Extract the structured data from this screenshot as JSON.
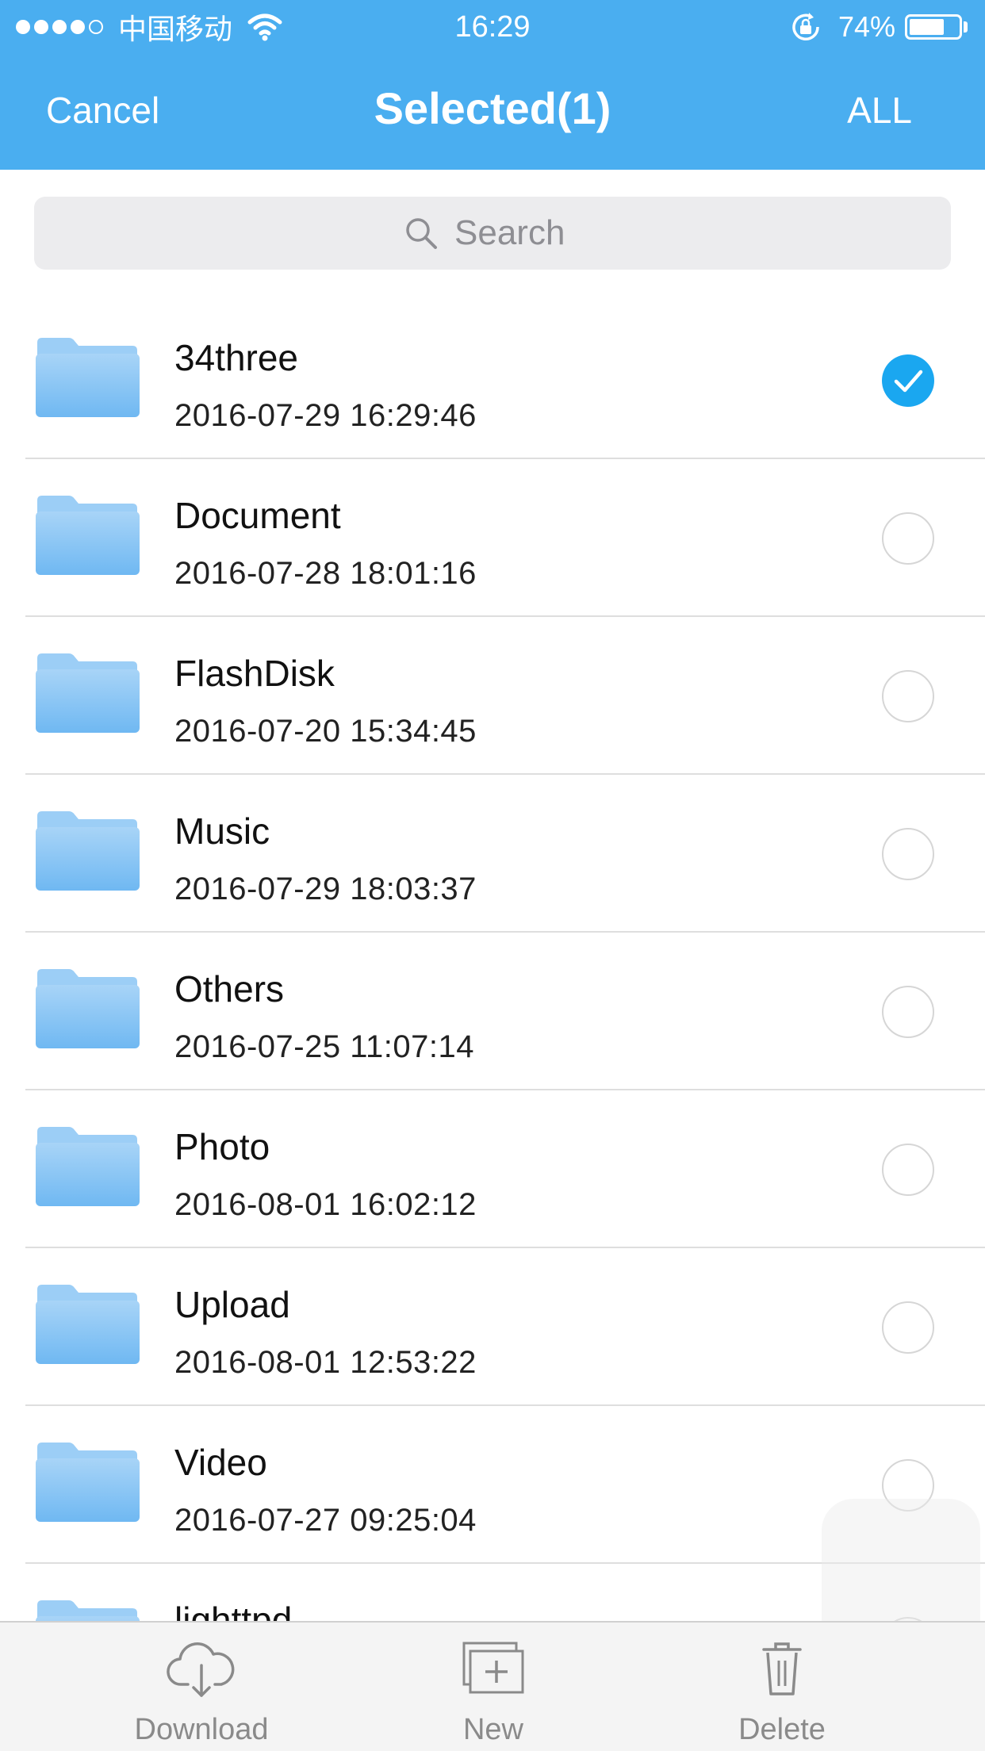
{
  "status_bar": {
    "carrier": "中国移动",
    "time": "16:29",
    "battery": "74%",
    "battery_level": 0.74,
    "signal_dots_filled": 4,
    "signal_dots_total": 5
  },
  "nav": {
    "cancel_label": "Cancel",
    "title": "Selected(1)",
    "all_label": "ALL"
  },
  "search": {
    "placeholder": "Search"
  },
  "files": [
    {
      "name": "34three",
      "date": "2016-07-29 16:29:46",
      "selected": true
    },
    {
      "name": "Document",
      "date": "2016-07-28 18:01:16",
      "selected": false
    },
    {
      "name": "FlashDisk",
      "date": "2016-07-20 15:34:45",
      "selected": false
    },
    {
      "name": "Music",
      "date": "2016-07-29 18:03:37",
      "selected": false
    },
    {
      "name": "Others",
      "date": "2016-07-25 11:07:14",
      "selected": false
    },
    {
      "name": "Photo",
      "date": "2016-08-01 16:02:12",
      "selected": false
    },
    {
      "name": "Upload",
      "date": "2016-08-01 12:53:22",
      "selected": false
    },
    {
      "name": "Video",
      "date": "2016-07-27 09:25:04",
      "selected": false
    },
    {
      "name": "lighttpd",
      "date": "",
      "selected": false
    }
  ],
  "toolbar": {
    "download_label": "Download",
    "new_label": "New",
    "delete_label": "Delete"
  },
  "colors": {
    "accent": "#4aaef0",
    "check": "#1aa7f0",
    "folder": "#8fc8f5"
  },
  "icons": [
    "wifi-icon",
    "rotation-lock-icon",
    "battery-icon",
    "search-icon",
    "folder-icon",
    "checkmark-icon",
    "cloud-download-icon",
    "new-folder-icon",
    "trash-icon"
  ]
}
